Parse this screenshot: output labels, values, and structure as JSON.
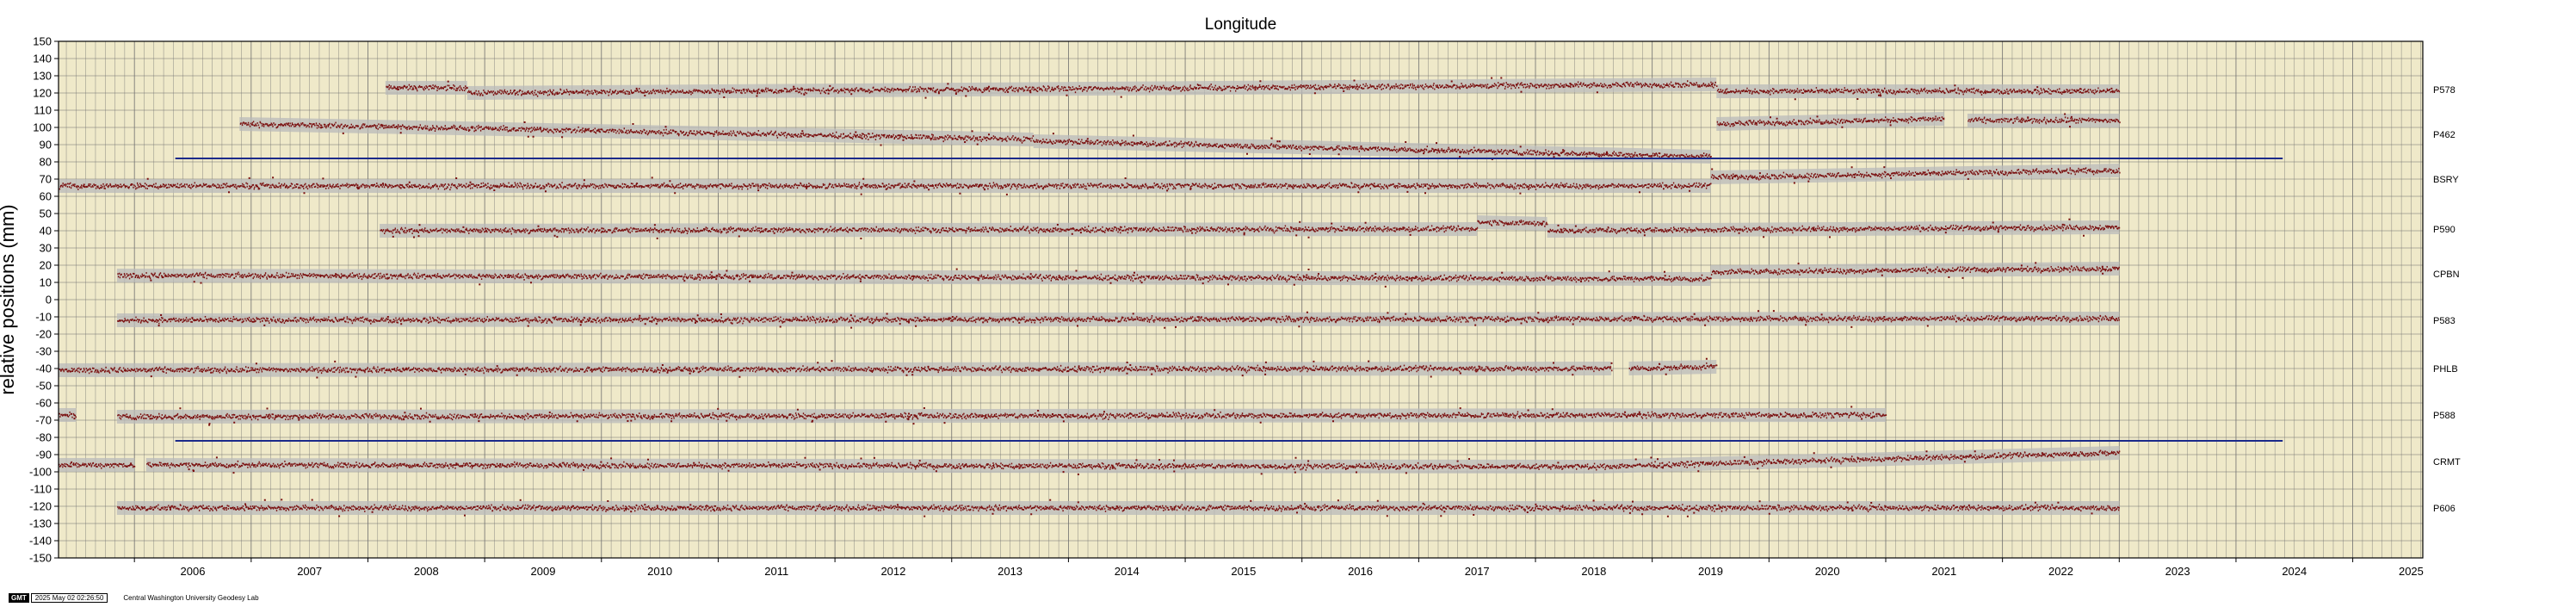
{
  "chart_data": {
    "type": "scatter",
    "title": "Longitude",
    "ylabel": "relative positions (mm)",
    "xlim": [
      2005.35,
      2025.6
    ],
    "ylim": [
      -150,
      150
    ],
    "y_ticks": [
      150,
      140,
      130,
      120,
      110,
      100,
      90,
      80,
      70,
      60,
      50,
      40,
      30,
      20,
      10,
      0,
      -10,
      -20,
      -30,
      -40,
      -50,
      -60,
      -70,
      -80,
      -90,
      -100,
      -110,
      -120,
      -130,
      -140,
      -150
    ],
    "x_ticks": [
      "2006",
      "2007",
      "2008",
      "2009",
      "2010",
      "2011",
      "2012",
      "2013",
      "2014",
      "2015",
      "2016",
      "2017",
      "2018",
      "2019",
      "2020",
      "2021",
      "2022",
      "2023",
      "2024",
      "2025"
    ],
    "grid": true,
    "colors": {
      "background": "#efe9c9",
      "grid": "#6f6f6f",
      "points": "#7a0f0f",
      "error_band": "#b9b9b9",
      "reference_line": "#1b2a8a"
    },
    "reference_lines": [
      {
        "y": 82,
        "x": [
          2006.35,
          2024.4
        ]
      },
      {
        "y": -82,
        "x": [
          2006.35,
          2024.4
        ]
      }
    ],
    "series": [
      {
        "name": "P578",
        "offset": 122,
        "segments": [
          {
            "x": [
              2008.15,
              2008.85
            ],
            "y": [
              123,
              123
            ]
          },
          {
            "x": [
              2008.85,
              2019.55
            ],
            "y": [
              120,
              125
            ]
          },
          {
            "x": [
              2019.55,
              2023.0
            ],
            "y": [
              121,
              121
            ]
          }
        ]
      },
      {
        "name": "P462",
        "offset": 96,
        "segments": [
          {
            "x": [
              2006.9,
              2013.7
            ],
            "y": [
              102,
              93
            ]
          },
          {
            "x": [
              2013.7,
              2019.5
            ],
            "y": [
              92,
              83
            ]
          },
          {
            "x": [
              2019.55,
              2021.5
            ],
            "y": [
              102,
              105
            ]
          },
          {
            "x": [
              2021.7,
              2023.0
            ],
            "y": [
              104,
              104
            ]
          }
        ]
      },
      {
        "name": "BSRY",
        "offset": 70,
        "segments": [
          {
            "x": [
              2005.35,
              2019.5
            ],
            "y": [
              66,
              66
            ]
          },
          {
            "x": [
              2019.5,
              2023.0
            ],
            "y": [
              71,
              75
            ]
          }
        ]
      },
      {
        "name": "P590",
        "offset": 41,
        "segments": [
          {
            "x": [
              2008.1,
              2017.5
            ],
            "y": [
              40,
              41
            ]
          },
          {
            "x": [
              2017.5,
              2018.1
            ],
            "y": [
              45,
              44
            ]
          },
          {
            "x": [
              2018.1,
              2023.0
            ],
            "y": [
              40,
              42
            ]
          }
        ]
      },
      {
        "name": "CPBN",
        "offset": 15,
        "segments": [
          {
            "x": [
              2005.85,
              2019.5
            ],
            "y": [
              14,
              12
            ]
          },
          {
            "x": [
              2019.5,
              2023.0
            ],
            "y": [
              16,
              18
            ]
          }
        ]
      },
      {
        "name": "P583",
        "offset": -12,
        "segments": [
          {
            "x": [
              2005.85,
              2023.0
            ],
            "y": [
              -12,
              -11
            ]
          }
        ]
      },
      {
        "name": "PHLB",
        "offset": -40,
        "segments": [
          {
            "x": [
              2005.35,
              2018.65
            ],
            "y": [
              -41,
              -40
            ]
          },
          {
            "x": [
              2018.8,
              2019.55
            ],
            "y": [
              -40,
              -39
            ]
          }
        ]
      },
      {
        "name": "P588",
        "offset": -67,
        "segments": [
          {
            "x": [
              2005.35,
              2005.5
            ],
            "y": [
              -67,
              -67
            ]
          },
          {
            "x": [
              2005.85,
              2021.0
            ],
            "y": [
              -68,
              -67
            ]
          }
        ]
      },
      {
        "name": "CRMT",
        "offset": -94,
        "segments": [
          {
            "x": [
              2005.35,
              2006.0
            ],
            "y": [
              -96,
              -96
            ]
          },
          {
            "x": [
              2006.1,
              2018.5
            ],
            "y": [
              -96,
              -97
            ]
          },
          {
            "x": [
              2018.5,
              2023.0
            ],
            "y": [
              -97,
              -89
            ]
          }
        ]
      },
      {
        "name": "P606",
        "offset": -121,
        "segments": [
          {
            "x": [
              2005.85,
              2023.0
            ],
            "y": [
              -121,
              -121
            ]
          }
        ]
      }
    ]
  },
  "footer": {
    "logo": "GMT",
    "timestamp": "2025 May 02 02:26:50",
    "credit": "Central Washington University Geodesy Lab"
  }
}
